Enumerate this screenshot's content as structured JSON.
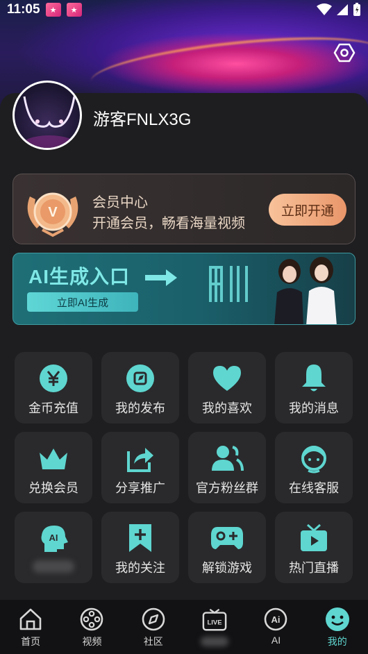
{
  "status_bar": {
    "time": "11:05"
  },
  "profile": {
    "username": "游客FNLX3G"
  },
  "vip": {
    "title": "会员中心",
    "subtitle": "开通会员，畅看海量视频",
    "button": "立即开通"
  },
  "ai_banner": {
    "title": "AI生成入口",
    "button": "立即AI生成"
  },
  "grid": [
    {
      "label": "金币充值",
      "icon": "yen-coin-icon"
    },
    {
      "label": "我的发布",
      "icon": "compass-publish-icon"
    },
    {
      "label": "我的喜欢",
      "icon": "heart-icon"
    },
    {
      "label": "我的消息",
      "icon": "bell-icon"
    },
    {
      "label": "兑换会员",
      "icon": "crown-icon"
    },
    {
      "label": "分享推广",
      "icon": "share-icon"
    },
    {
      "label": "官方粉丝群",
      "icon": "group-icon"
    },
    {
      "label": "在线客服",
      "icon": "customer-service-icon"
    },
    {
      "label": "",
      "icon": "ai-head-icon"
    },
    {
      "label": "我的关注",
      "icon": "bookmark-plus-icon"
    },
    {
      "label": "解锁游戏",
      "icon": "gamepad-icon"
    },
    {
      "label": "热门直播",
      "icon": "tv-live-icon"
    }
  ],
  "tabs": [
    {
      "label": "首页",
      "icon": "home-icon"
    },
    {
      "label": "视频",
      "icon": "film-reel-icon"
    },
    {
      "label": "社区",
      "icon": "compass-icon"
    },
    {
      "label": "",
      "icon": "live-tv-icon"
    },
    {
      "label": "AI",
      "icon": "ai-icon"
    },
    {
      "label": "我的",
      "icon": "smiley-icon"
    }
  ],
  "colors": {
    "accent": "#5fd6d0",
    "vip_button": "#f0a77c",
    "tile_bg": "#2a2a2c"
  }
}
